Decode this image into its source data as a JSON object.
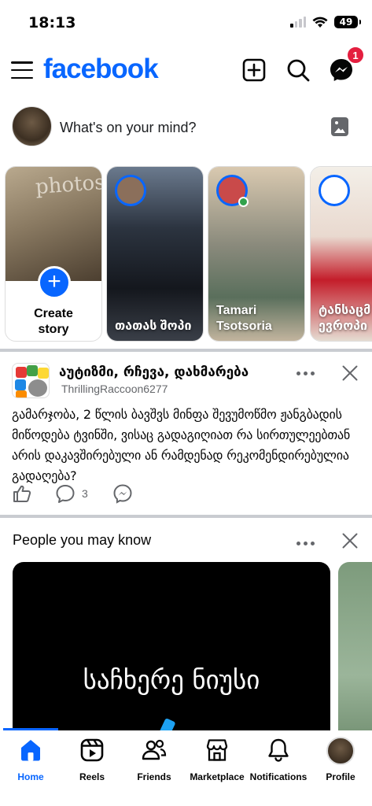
{
  "status_bar": {
    "time": "18:13",
    "battery": "49"
  },
  "header": {
    "logo": "facebook",
    "icons": [
      "menu-icon",
      "create-icon",
      "search-icon",
      "messenger-icon"
    ],
    "messenger_badge": "1"
  },
  "composer": {
    "placeholder": "What's on your mind?"
  },
  "stories": {
    "create_label": "Create story",
    "create_photo_text": "photos",
    "items": [
      {
        "name": "თათას შოპი"
      },
      {
        "name": "Tamari Tsotsoria"
      },
      {
        "name": "ტანსაცმ ევროპი"
      }
    ]
  },
  "post": {
    "group": "აუტიზმი, რჩევა, დახმარება",
    "author": "ThrillingRaccoon6277",
    "text": "გამარჯობა, 2 წლის ბავშვს მინფა შევუმოწმო ჟანგბადის მიწოდება ტვინში, ვისაც გადაგიღიათ რა სირთულეებთან არის დაკავშირებული ან რამდენად რეკომენდირებულია გადაღება?",
    "comment_count": "3"
  },
  "pymk": {
    "title": "People you may know",
    "card_text": "საჩხერე ნიუსი"
  },
  "tabbar": {
    "tabs": [
      {
        "label": "Home"
      },
      {
        "label": "Reels"
      },
      {
        "label": "Friends"
      },
      {
        "label": "Marketplace"
      },
      {
        "label": "Notifications"
      },
      {
        "label": "Profile"
      }
    ]
  },
  "colors": {
    "brand": "#0866ff",
    "badge": "#e41e3f",
    "secondary_text": "#65676b"
  }
}
